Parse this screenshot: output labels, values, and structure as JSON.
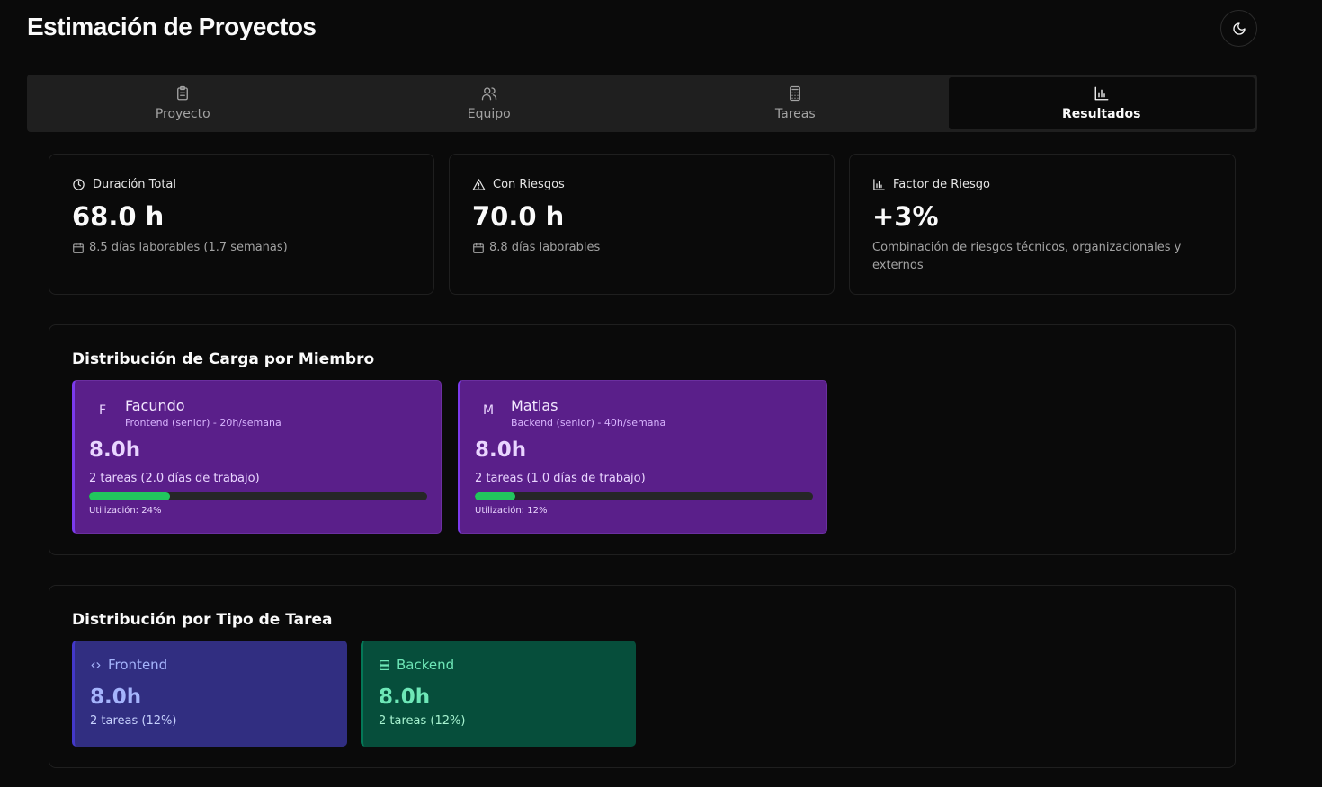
{
  "app": {
    "title": "Estimación de Proyectos",
    "theme_toggle_icon": "moon-icon"
  },
  "tabs": [
    {
      "label": "Proyecto",
      "icon": "clipboard-icon",
      "active": false
    },
    {
      "label": "Equipo",
      "icon": "users-icon",
      "active": false
    },
    {
      "label": "Tareas",
      "icon": "calculator-icon",
      "active": false
    },
    {
      "label": "Resultados",
      "icon": "bar-chart-icon",
      "active": true
    }
  ],
  "stats": {
    "duration": {
      "label": "Duración Total",
      "value": "68.0 h",
      "sub": "8.5 días laborables (1.7 semanas)"
    },
    "risk": {
      "label": "Con Riesgos",
      "value": "70.0 h",
      "sub": "8.8 días laborables"
    },
    "factor": {
      "label": "Factor de Riesgo",
      "value": "+3%",
      "sub": "Combinación de riesgos técnicos, organizacionales y externos"
    }
  },
  "members_section": {
    "title": "Distribución de Carga por Miembro",
    "members": [
      {
        "initial": "F",
        "name": "Facundo",
        "role": "Frontend (senior) - 20h/semana",
        "hours": "8.0h",
        "tasks": "2 tareas (2.0 días de trabajo)",
        "utilization_label": "Utilización: 24%",
        "utilization": 0.24
      },
      {
        "initial": "M",
        "name": "Matias",
        "role": "Backend (senior) - 40h/semana",
        "hours": "8.0h",
        "tasks": "2 tareas (1.0 días de trabajo)",
        "utilization_label": "Utilización: 12%",
        "utilization": 0.12
      }
    ]
  },
  "types_section": {
    "title": "Distribución por Tipo de Tarea",
    "types": [
      {
        "name": "Frontend",
        "icon": "code-icon",
        "hours": "8.0h",
        "tasks": "2 tareas (12%)"
      },
      {
        "name": "Backend",
        "icon": "server-icon",
        "hours": "8.0h",
        "tasks": "2 tareas (12%)"
      }
    ]
  },
  "colors": {
    "accent_bar": "#22c55e",
    "member_bg": "#5a1f8a",
    "frontend_bg": "#312e81",
    "backend_bg": "#064e3b"
  }
}
